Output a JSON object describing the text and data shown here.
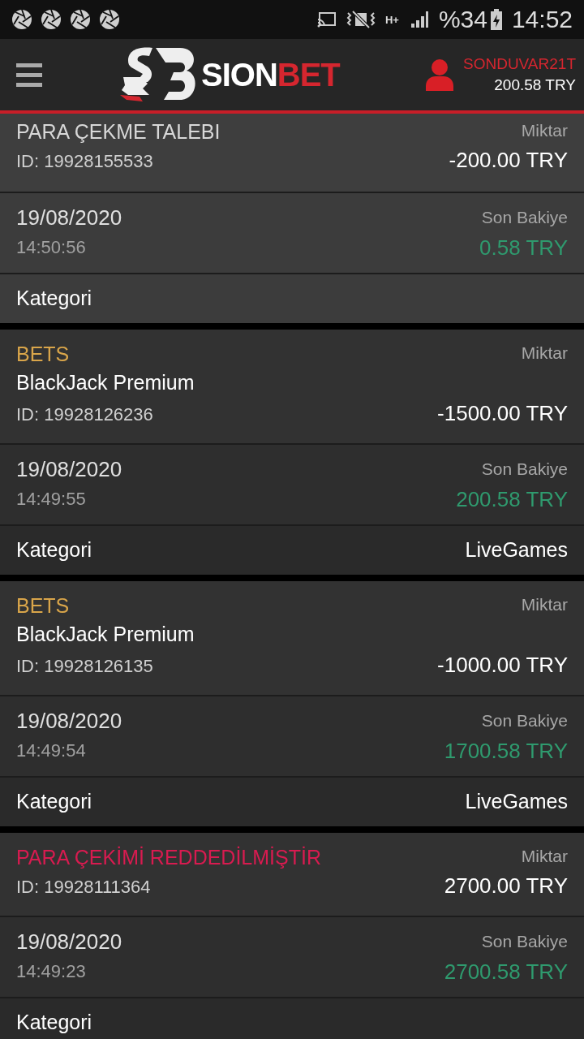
{
  "status_bar": {
    "network": "H+",
    "battery": "%34",
    "time": "14:52"
  },
  "header": {
    "logo_word_1": "SION",
    "logo_word_2": "BET",
    "username": "SONDUVAR21T",
    "balance": "200.58 TRY"
  },
  "transactions": [
    {
      "kind": "withdrawal_request",
      "highlighted": true,
      "title": "PARA ÇEKME TALEBI",
      "amount_label": "Miktar",
      "id": "ID: 19928155533",
      "amount": "-200.00 TRY",
      "date": "19/08/2020",
      "time": "14:50:56",
      "balance_label": "Son Bakiye",
      "balance": "0.58 TRY",
      "category_label": "Kategori"
    },
    {
      "kind": "bet",
      "highlighted": false,
      "title": "BETS",
      "game": "BlackJack Premium",
      "amount_label": "Miktar",
      "id": "ID: 19928126236",
      "amount": "-1500.00 TRY",
      "date": "19/08/2020",
      "time": "14:49:55",
      "balance_label": "Son Bakiye",
      "balance": "200.58 TRY",
      "category_label": "Kategori",
      "category": "LiveGames"
    },
    {
      "kind": "bet",
      "highlighted": false,
      "title": "BETS",
      "game": "BlackJack Premium",
      "amount_label": "Miktar",
      "id": "ID: 19928126135",
      "amount": "-1000.00 TRY",
      "date": "19/08/2020",
      "time": "14:49:54",
      "balance_label": "Son Bakiye",
      "balance": "1700.58 TRY",
      "category_label": "Kategori",
      "category": "LiveGames"
    },
    {
      "kind": "withdrawal_rejected",
      "highlighted": false,
      "title": "PARA ÇEKİMİ REDDEDİLMİŞTİR",
      "amount_label": "Miktar",
      "id": "ID: 19928111364",
      "amount": "2700.00 TRY",
      "date": "19/08/2020",
      "time": "14:49:23",
      "balance_label": "Son Bakiye",
      "balance": "2700.58 TRY",
      "category_label": "Kategori"
    }
  ]
}
